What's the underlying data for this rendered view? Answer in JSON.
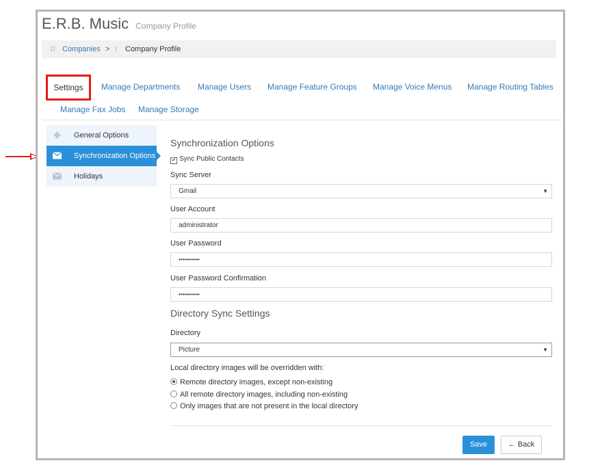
{
  "header": {
    "title": "E.R.B. Music",
    "subtitle": "Company Profile"
  },
  "breadcrumb": {
    "home_icon": "home-icon",
    "link": "Companies",
    "chevron": ">",
    "separator": "/",
    "current": "Company Profile"
  },
  "tabs": [
    {
      "label": "Settings",
      "active": true
    },
    {
      "label": "Manage Departments"
    },
    {
      "label": "Manage Users"
    },
    {
      "label": "Manage Feature Groups"
    },
    {
      "label": "Manage Voice Menus"
    },
    {
      "label": "Manage Routing Tables"
    },
    {
      "label": "Manage Fax Jobs"
    },
    {
      "label": "Manage Storage"
    }
  ],
  "sidebar": {
    "items": [
      {
        "label": "General Options",
        "icon": "gear-icon"
      },
      {
        "label": "Synchronization Options",
        "icon": "envelope-icon",
        "active": true
      },
      {
        "label": "Holidays",
        "icon": "envelope-icon"
      }
    ]
  },
  "form": {
    "section_title": "Synchronization Options",
    "sync_public_contacts": {
      "label": "Sync Public Contacts",
      "checked": true
    },
    "sync_server": {
      "label": "Sync Server",
      "value": "Gmail"
    },
    "user_account": {
      "label": "User Account",
      "value": "administrator"
    },
    "user_password": {
      "label": "User Password",
      "value": "•••••••••••"
    },
    "user_password_confirmation": {
      "label": "User Password Confirmation",
      "value": "•••••••••••"
    },
    "directory_section_title": "Directory Sync Settings",
    "directory": {
      "label": "Directory",
      "value": "Picture"
    },
    "override_label": "Local directory images will be overridden with:",
    "override_options": [
      {
        "label": "Remote directory images, except non-existing",
        "selected": true
      },
      {
        "label": "All remote directory images, including non-existing",
        "selected": false
      },
      {
        "label": "Only images that are not present in the local directory",
        "selected": false
      }
    ]
  },
  "buttons": {
    "save": "Save",
    "back": "← Back"
  },
  "colors": {
    "accent": "#2a90d9",
    "link": "#337ab7",
    "highlight_box": "#e41b1b"
  }
}
